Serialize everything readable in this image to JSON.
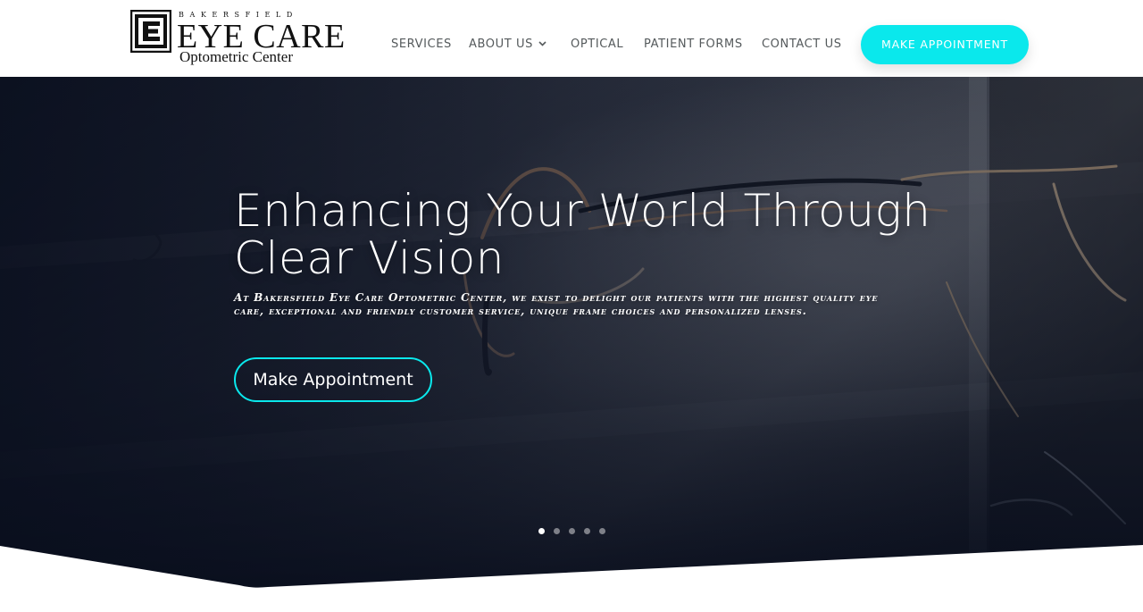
{
  "logo": {
    "top_text": "BAKERSFIELD",
    "main_text": "EYE CARE",
    "sub_text": "Optometric Center"
  },
  "nav": {
    "items": [
      {
        "label": "SERVICES"
      },
      {
        "label": "ABOUT US",
        "has_dropdown": true
      },
      {
        "label": "OPTICAL"
      },
      {
        "label": "PATIENT FORMS"
      },
      {
        "label": "CONTACT US"
      }
    ],
    "cta_label": "MAKE APPOINTMENT"
  },
  "hero": {
    "title": "Enhancing Your World Through Clear Vision",
    "subtitle": "At Bakersfield Eye Care Optometric Center, we exist to delight our patients with the highest quality eye care, exceptional and friendly customer service, unique frame choices and personalized lenses.",
    "button_label": "Make Appointment",
    "slides_total": 5,
    "active_slide": 1
  },
  "colors": {
    "accent": "#0ae8ec",
    "nav_text": "#555a5c",
    "hero_dark": "#0f1627"
  },
  "icons": {
    "dropdown": "chevron-down-icon",
    "logo": "logo-e-mark"
  }
}
